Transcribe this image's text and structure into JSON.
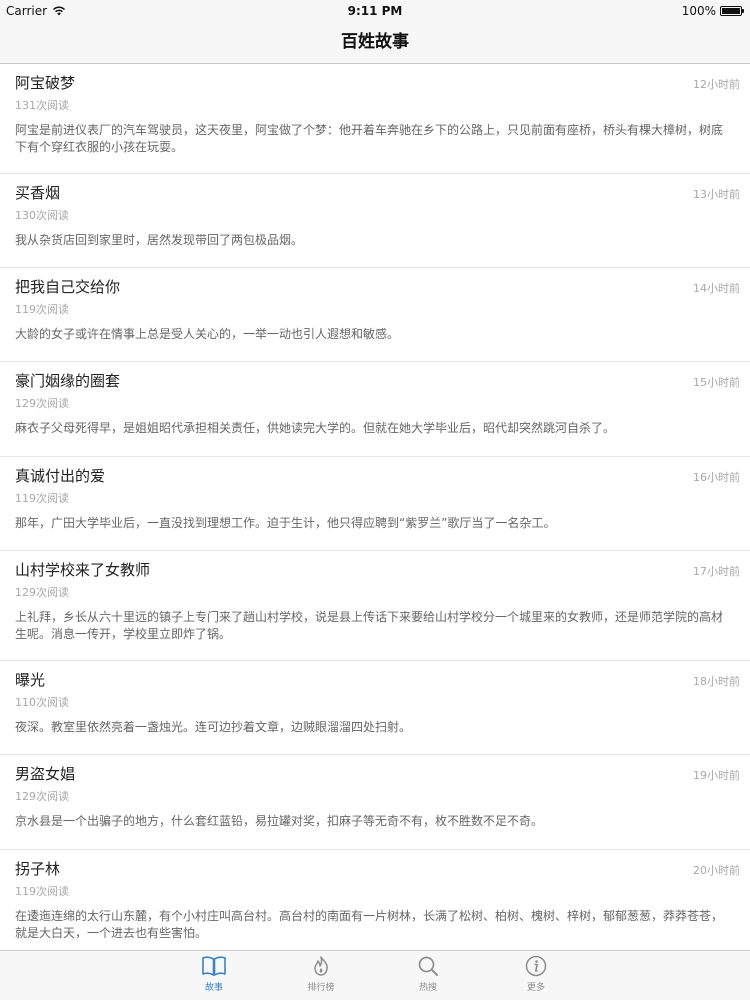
{
  "status": {
    "carrier": "Carrier",
    "time": "9:11 PM",
    "battery": "100%",
    "battery_level": 1.0
  },
  "nav": {
    "title": "百姓故事"
  },
  "stories": [
    {
      "title": "阿宝破梦",
      "time": "12小时前",
      "reads": "131次阅读",
      "summary": "阿宝是前进仪表厂的汽车驾驶员，这天夜里，阿宝做了个梦：他开着车奔驰在乡下的公路上，只见前面有座桥，桥头有棵大樟树，树底下有个穿红衣服的小孩在玩耍。"
    },
    {
      "title": "买香烟",
      "time": "13小时前",
      "reads": "130次阅读",
      "summary": "我从杂货店回到家里时，居然发现带回了两包极品烟。"
    },
    {
      "title": "把我自己交给你",
      "time": "14小时前",
      "reads": "119次阅读",
      "summary": "大龄的女子或许在情事上总是受人关心的，一举一动也引人遐想和敏感。"
    },
    {
      "title": "豪门姻缘的圈套",
      "time": "15小时前",
      "reads": "129次阅读",
      "summary": "麻衣子父母死得早，是姐姐昭代承担相关责任，供她读完大学的。但就在她大学毕业后，昭代却突然跳河自杀了。"
    },
    {
      "title": "真诚付出的爱",
      "time": "16小时前",
      "reads": "119次阅读",
      "summary": "那年，广田大学毕业后，一直没找到理想工作。迫于生计，他只得应聘到“紫罗兰”歌厅当了一名杂工。"
    },
    {
      "title": "山村学校来了女教师",
      "time": "17小时前",
      "reads": "129次阅读",
      "summary": "上礼拜，乡长从六十里远的镇子上专门来了趟山村学校，说是县上传话下来要给山村学校分一个城里来的女教师，还是师范学院的高材生呢。消息一传开，学校里立即炸了锅。"
    },
    {
      "title": "曝光",
      "time": "18小时前",
      "reads": "110次阅读",
      "summary": "夜深。教室里依然亮着一盏烛光。连可边抄着文章，边贼眼溜溜四处扫射。"
    },
    {
      "title": "男盗女娼",
      "time": "19小时前",
      "reads": "129次阅读",
      "summary": "京水县是一个出骗子的地方，什么套红蓝铅，易拉罐对奖，扣麻子等无奇不有，枚不胜数不足不奇。"
    },
    {
      "title": "拐子林",
      "time": "20小时前",
      "reads": "119次阅读",
      "summary": "在逶迤连绵的太行山东麓，有个小村庄叫高台村。高台村的南面有一片树林，长满了松树、柏树、槐树、梓树，郁郁葱葱，莽莽苍苍，就是大白天，一个进去也有些害怕。"
    }
  ],
  "tabs": [
    {
      "label": "故事",
      "icon": "book-icon",
      "active": true
    },
    {
      "label": "排行榜",
      "icon": "flame-icon",
      "active": false
    },
    {
      "label": "热搜",
      "icon": "search-icon",
      "active": false
    },
    {
      "label": "更多",
      "icon": "info-icon",
      "active": false
    }
  ],
  "colors": {
    "accent": "#3b82c4",
    "muted": "#a8a8a8"
  }
}
